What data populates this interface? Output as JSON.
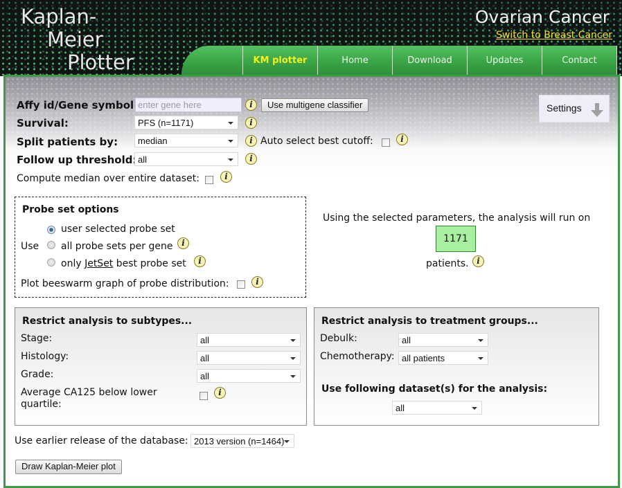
{
  "header": {
    "logo_lines": [
      "Kaplan-",
      "Meier",
      "Plotter"
    ],
    "site_title": "Ovarian Cancer",
    "switch_link": "Switch to Breast Cancer",
    "nav": [
      {
        "label": "KM plotter",
        "active": true
      },
      {
        "label": "Home",
        "active": false
      },
      {
        "label": "Download",
        "active": false
      },
      {
        "label": "Updates",
        "active": false
      },
      {
        "label": "Contact",
        "active": false
      }
    ]
  },
  "form": {
    "gene": {
      "label": "Affy id/Gene symbol:",
      "value": "",
      "placeholder": "enter gene here"
    },
    "multigene_button": "Use multigene classifier",
    "survival": {
      "label": "Survival:",
      "value": "PFS (n=1171)"
    },
    "split": {
      "label": "Split patients by:",
      "value": "median"
    },
    "auto_cutoff": {
      "label": "Auto select best cutoff:",
      "checked": false
    },
    "follow_up": {
      "label": "Follow up threshold:",
      "value": "all"
    },
    "compute_median": {
      "label": "Compute median over entire dataset:",
      "checked": false
    },
    "settings_button": "Settings",
    "info_glyph": "i"
  },
  "probe_set": {
    "title": "Probe set options",
    "use_label": "Use",
    "options": [
      {
        "label": "user selected probe set",
        "checked": true
      },
      {
        "label": "all probe sets per gene",
        "checked": false
      },
      {
        "label_pre": "only ",
        "link": "JetSet",
        "label_post": " best probe set",
        "checked": false
      }
    ],
    "beeswarm": {
      "label": "Plot beeswarm graph of probe distribution:",
      "checked": false
    }
  },
  "summary": {
    "text_before": "Using the selected parameters, the analysis will run on",
    "count": "1171",
    "text_after": "patients."
  },
  "subtypes": {
    "title": "Restrict analysis to subtypes...",
    "stage": {
      "label": "Stage:",
      "value": "all"
    },
    "histology": {
      "label": "Histology:",
      "value": "all"
    },
    "grade": {
      "label": "Grade:",
      "value": "all"
    },
    "ca125": {
      "label_line1": "Average CA125 below lower",
      "label_line2": "quartile:",
      "checked": false
    }
  },
  "treatment": {
    "title": "Restrict analysis to treatment groups...",
    "debulk": {
      "label": "Debulk:",
      "value": "all"
    },
    "chemo": {
      "label": "Chemotherapy:",
      "value": "all patients"
    },
    "dataset_title": "Use following dataset(s) for the analysis:",
    "dataset": {
      "value": "all"
    }
  },
  "release": {
    "label": "Use earlier release of the database:",
    "value": "2013 version (n=1464)"
  },
  "draw_button": "Draw Kaplan-Meier plot",
  "colors": {
    "nav_green": "#3aa546",
    "active_nav": "#f4f01a",
    "count_box": "#a8f0a0",
    "frame_border": "#3e9a46"
  }
}
